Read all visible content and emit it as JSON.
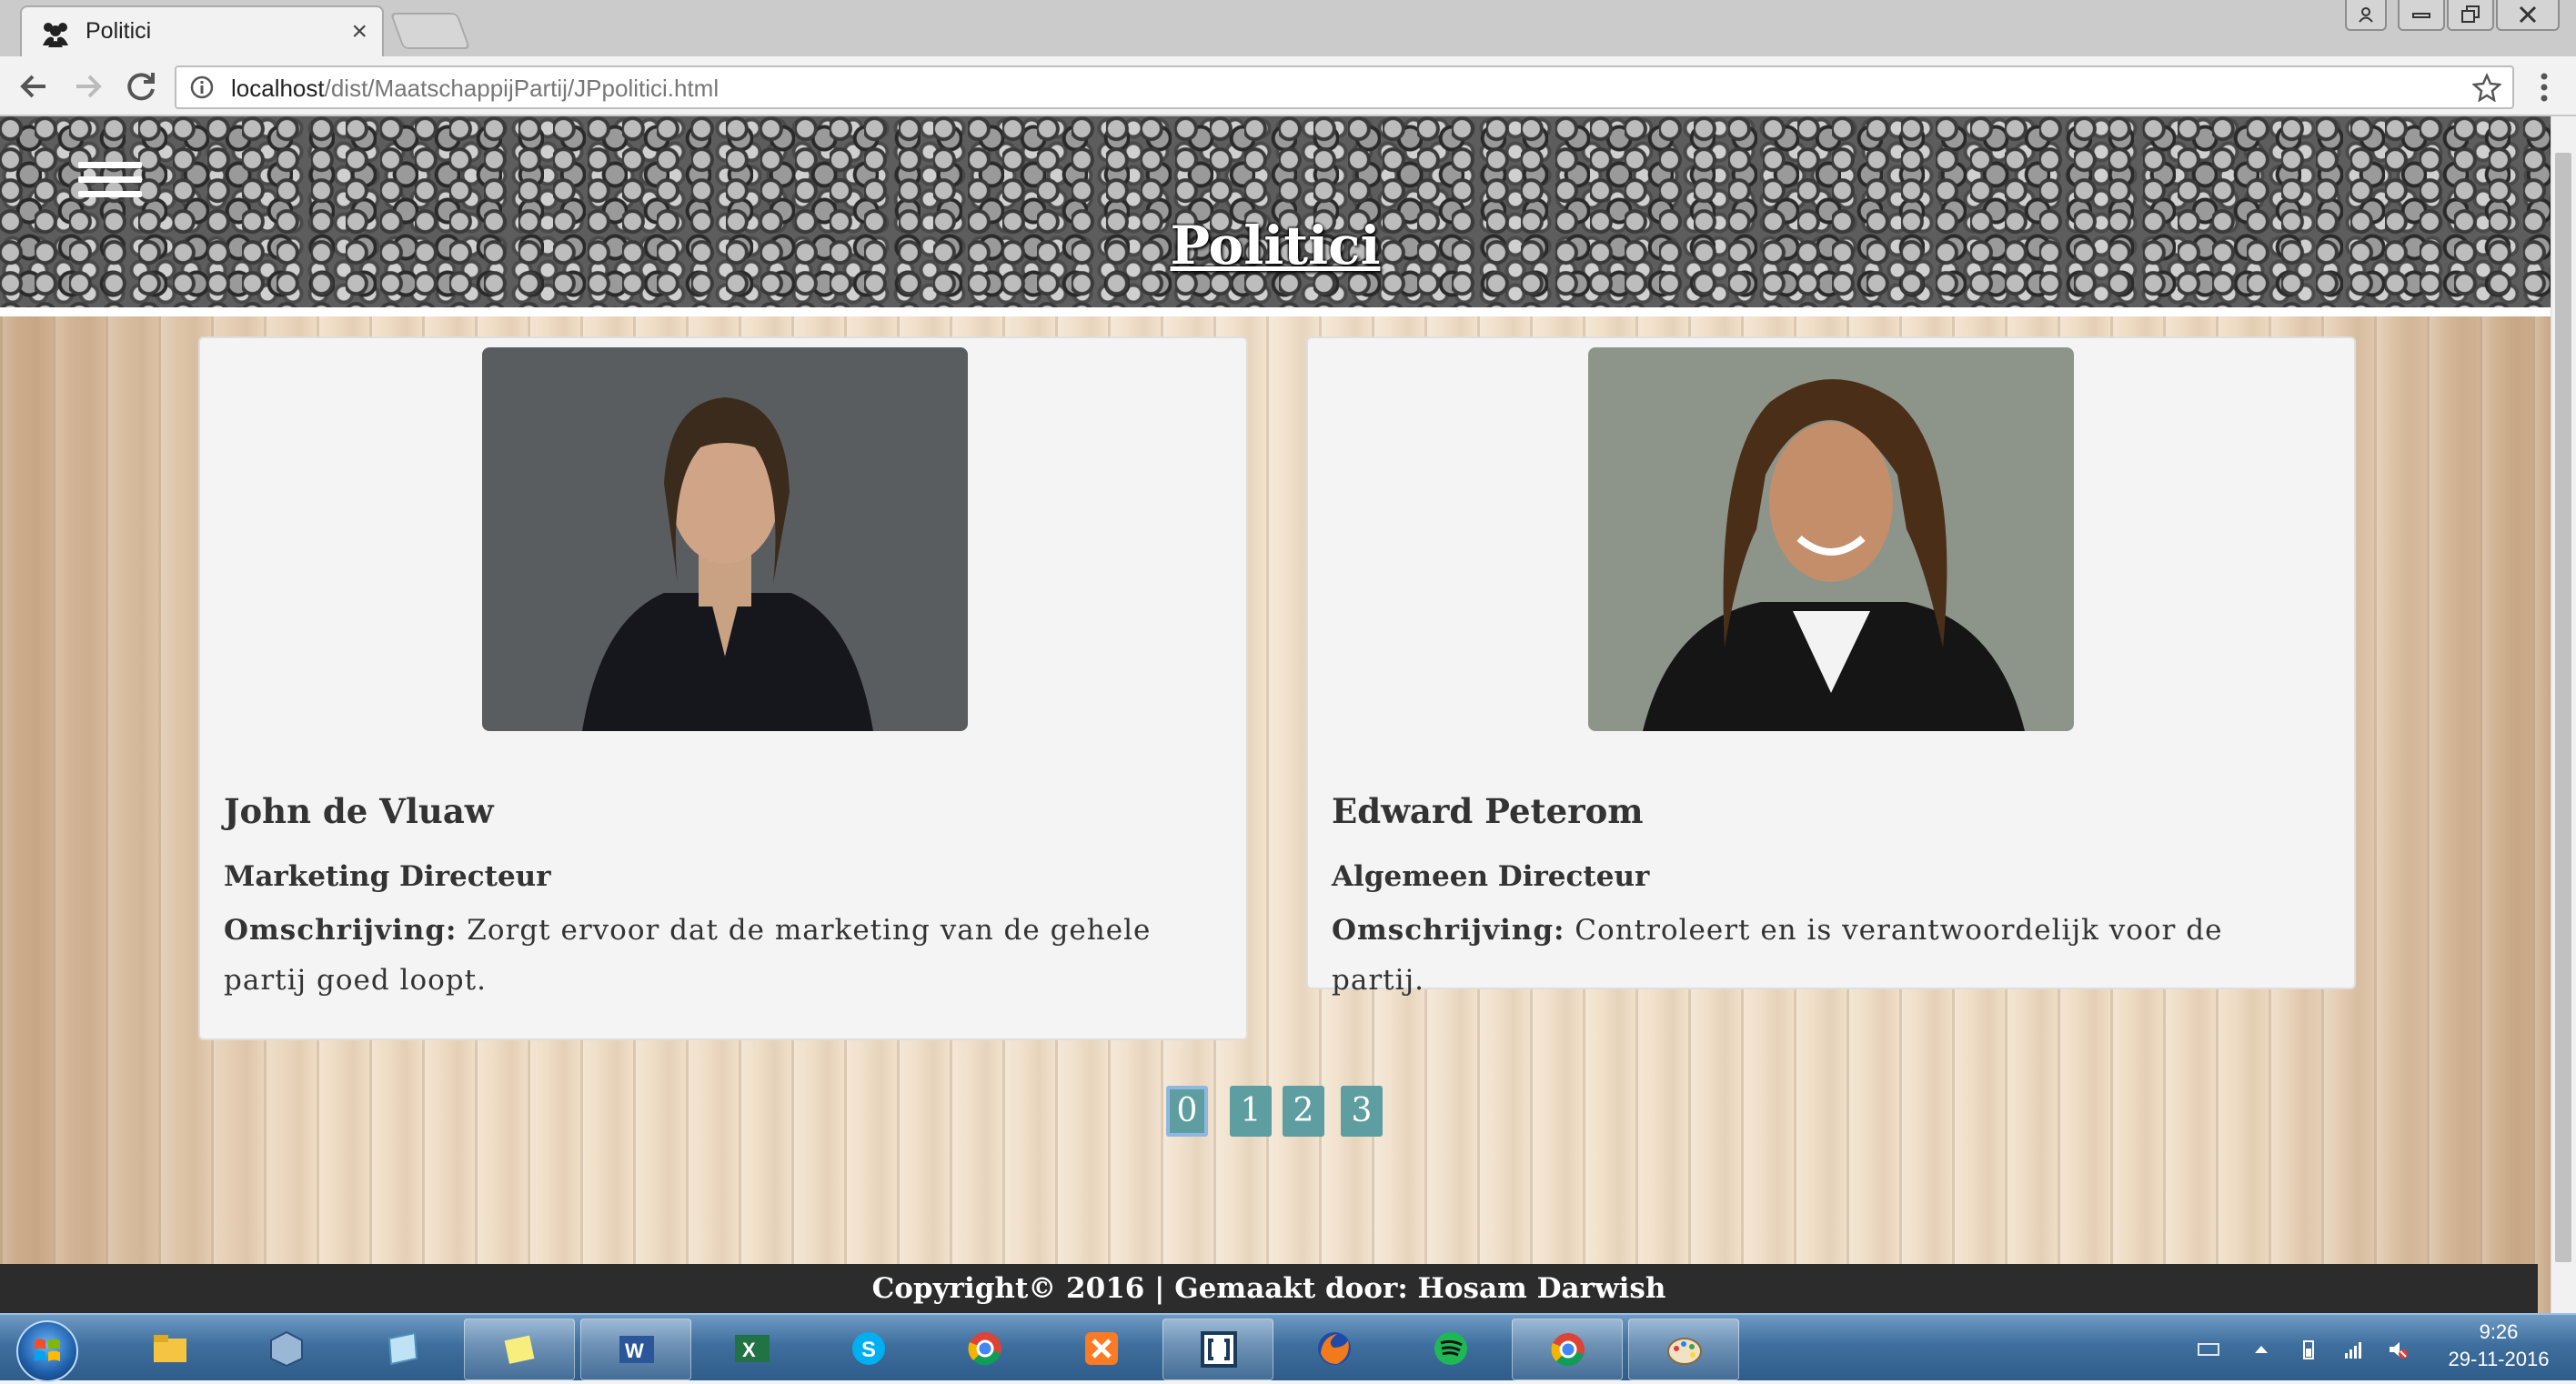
{
  "browser": {
    "tab_title": "Politici",
    "tab_close": "×",
    "url_host": "localhost",
    "url_path": "/dist/MaatschappijPartij/JPpolitici.html"
  },
  "page": {
    "title": "Politici",
    "cards": [
      {
        "name": "John de Vluaw",
        "role": "Marketing Directeur",
        "desc_label": "Omschrijving:",
        "desc_text": " Zorgt ervoor dat de marketing van de gehele partij goed loopt."
      },
      {
        "name": "Edward Peterom",
        "role": "Algemeen Directeur",
        "desc_label": "Omschrijving:",
        "desc_text": " Controleert en is verantwoordelijk voor de partij."
      }
    ],
    "pagination": [
      "0",
      "1",
      "2",
      "3"
    ],
    "active_page": "0",
    "footer": "Copyright© 2016 | Gemaakt door: Hosam Darwish"
  },
  "taskbar": {
    "apps": [
      "explorer",
      "virtualbox",
      "notepad",
      "sticky-notes",
      "word",
      "excel",
      "skype",
      "chrome",
      "xampp",
      "brackets",
      "firefox",
      "spotify",
      "chrome",
      "paint"
    ],
    "time": "9:26",
    "date": "29-11-2016"
  }
}
